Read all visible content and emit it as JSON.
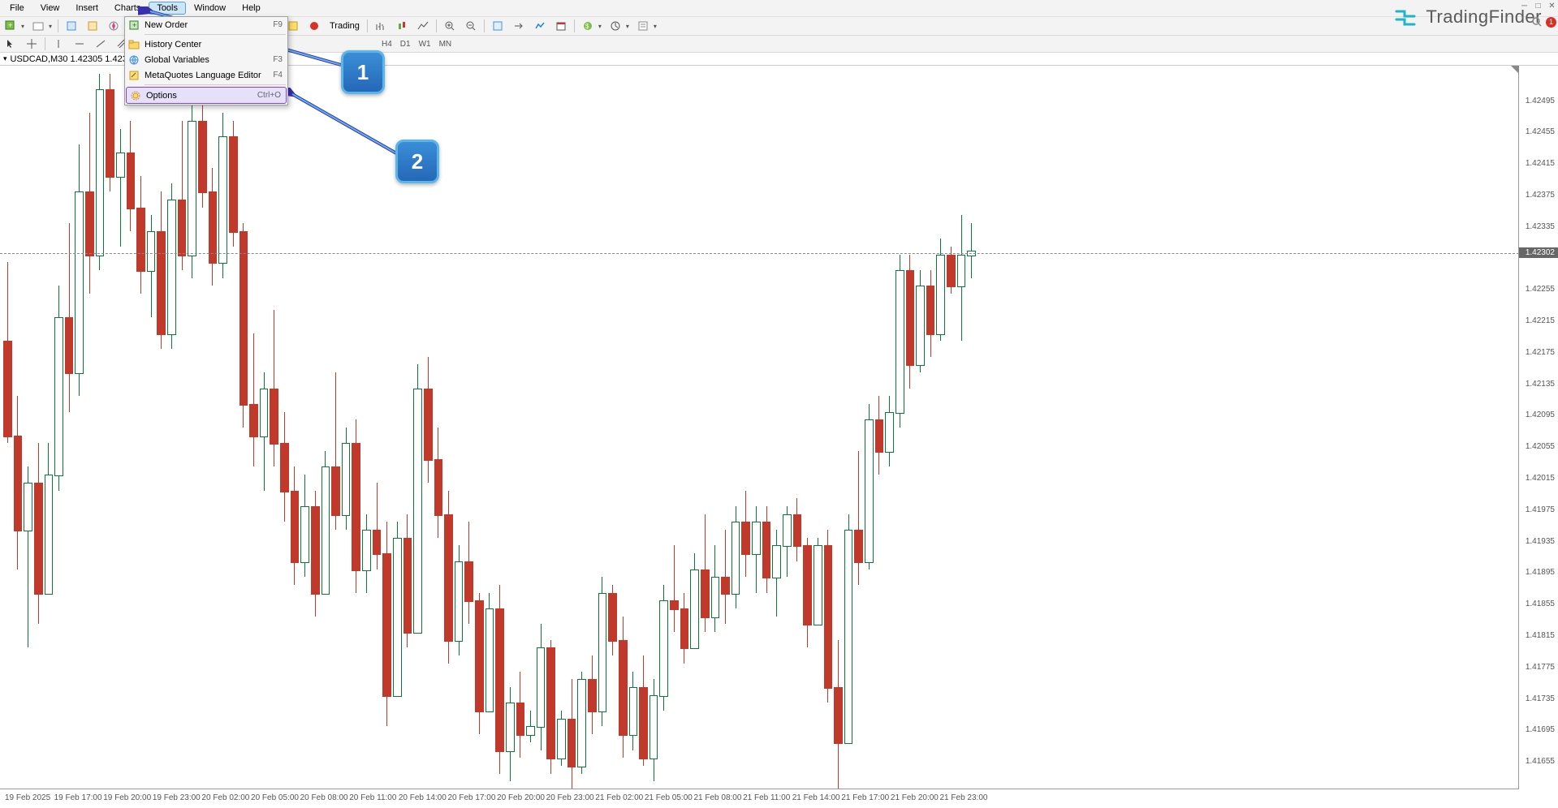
{
  "menu": {
    "items": [
      "File",
      "View",
      "Insert",
      "Charts",
      "Tools",
      "Window",
      "Help"
    ],
    "selected": 4
  },
  "dropdown": {
    "items": [
      {
        "label": "New Order",
        "shortcut": "F9",
        "icon": "plus"
      },
      {
        "sep": true
      },
      {
        "label": "History Center",
        "shortcut": "",
        "icon": "folder"
      },
      {
        "label": "Global Variables",
        "shortcut": "F3",
        "icon": "globe"
      },
      {
        "label": "MetaQuotes Language Editor",
        "shortcut": "F4",
        "icon": "edit"
      },
      {
        "sep": true
      },
      {
        "label": "Options",
        "shortcut": "Ctrl+O",
        "icon": "gear",
        "highlight": true
      }
    ]
  },
  "toolbar2_text": "Trading",
  "timeframes": [
    "H4",
    "D1",
    "W1",
    "MN"
  ],
  "chartTitle": "USDCAD,M30  1.42305 1.42350 1.42305 1.4230",
  "brand": "TradingFinder",
  "calloutNum": {
    "one": "1",
    "two": "2"
  },
  "notifCount": "1",
  "currentPrice": "1.42302",
  "chart_data": {
    "type": "candlestick",
    "symbol": "USDCAD",
    "period": "M30",
    "ylim": [
      1.4162,
      1.4254
    ],
    "yticks": [
      "1.42495",
      "1.42455",
      "1.42415",
      "1.42375",
      "1.42335",
      "1.42255",
      "1.42215",
      "1.42175",
      "1.42135",
      "1.42095",
      "1.42055",
      "1.42015",
      "1.41975",
      "1.41935",
      "1.41895",
      "1.41855",
      "1.41815",
      "1.41775",
      "1.41735",
      "1.41695",
      "1.41655"
    ],
    "xticks": [
      "19 Feb 2025",
      "19 Feb 17:00",
      "19 Feb 20:00",
      "19 Feb 23:00",
      "20 Feb 02:00",
      "20 Feb 05:00",
      "20 Feb 08:00",
      "20 Feb 11:00",
      "20 Feb 14:00",
      "20 Feb 17:00",
      "20 Feb 20:00",
      "20 Feb 23:00",
      "21 Feb 02:00",
      "21 Feb 05:00",
      "21 Feb 08:00",
      "21 Feb 11:00",
      "21 Feb 14:00",
      "21 Feb 17:00",
      "21 Feb 20:00",
      "21 Feb 23:00"
    ],
    "ohlc": [
      [
        1.4219,
        1.4229,
        1.4206,
        1.4207
      ],
      [
        1.4207,
        1.4212,
        1.419,
        1.4195
      ],
      [
        1.4195,
        1.4203,
        1.418,
        1.4201
      ],
      [
        1.4201,
        1.4206,
        1.4183,
        1.4187
      ],
      [
        1.4187,
        1.4206,
        1.4187,
        1.4202
      ],
      [
        1.4202,
        1.4226,
        1.42,
        1.4222
      ],
      [
        1.4222,
        1.4234,
        1.421,
        1.4215
      ],
      [
        1.4215,
        1.4244,
        1.4212,
        1.4238
      ],
      [
        1.4238,
        1.4248,
        1.4225,
        1.423
      ],
      [
        1.423,
        1.4253,
        1.4228,
        1.4251
      ],
      [
        1.4251,
        1.4253,
        1.4238,
        1.424
      ],
      [
        1.424,
        1.4246,
        1.4231,
        1.4243
      ],
      [
        1.4243,
        1.4247,
        1.4233,
        1.4236
      ],
      [
        1.4236,
        1.424,
        1.4225,
        1.4228
      ],
      [
        1.4228,
        1.4235,
        1.4222,
        1.4233
      ],
      [
        1.4233,
        1.4238,
        1.4218,
        1.422
      ],
      [
        1.422,
        1.4239,
        1.4218,
        1.4237
      ],
      [
        1.4237,
        1.4247,
        1.4228,
        1.423
      ],
      [
        1.423,
        1.4251,
        1.4227,
        1.4247
      ],
      [
        1.4247,
        1.425,
        1.4236,
        1.4238
      ],
      [
        1.4238,
        1.4241,
        1.4226,
        1.4229
      ],
      [
        1.4229,
        1.4248,
        1.4227,
        1.4245
      ],
      [
        1.4245,
        1.4247,
        1.4231,
        1.4233
      ],
      [
        1.4233,
        1.4234,
        1.4208,
        1.4211
      ],
      [
        1.4211,
        1.422,
        1.4203,
        1.4207
      ],
      [
        1.4207,
        1.4215,
        1.42,
        1.4213
      ],
      [
        1.4213,
        1.4223,
        1.4203,
        1.4206
      ],
      [
        1.4206,
        1.421,
        1.4196,
        1.42
      ],
      [
        1.42,
        1.4203,
        1.4188,
        1.4191
      ],
      [
        1.4191,
        1.4202,
        1.4189,
        1.4198
      ],
      [
        1.4198,
        1.42,
        1.4184,
        1.4187
      ],
      [
        1.4187,
        1.4205,
        1.4187,
        1.4203
      ],
      [
        1.4203,
        1.4215,
        1.4195,
        1.4197
      ],
      [
        1.4197,
        1.4208,
        1.4195,
        1.4206
      ],
      [
        1.4206,
        1.4209,
        1.4187,
        1.419
      ],
      [
        1.419,
        1.4197,
        1.4187,
        1.4195
      ],
      [
        1.4195,
        1.4201,
        1.419,
        1.4192
      ],
      [
        1.4192,
        1.4196,
        1.417,
        1.4174
      ],
      [
        1.4174,
        1.4196,
        1.4174,
        1.4194
      ],
      [
        1.4194,
        1.4197,
        1.418,
        1.4182
      ],
      [
        1.4182,
        1.4216,
        1.4182,
        1.4213
      ],
      [
        1.4213,
        1.4217,
        1.4201,
        1.4204
      ],
      [
        1.4204,
        1.4208,
        1.4194,
        1.4197
      ],
      [
        1.4197,
        1.42,
        1.4178,
        1.4181
      ],
      [
        1.4181,
        1.4193,
        1.4179,
        1.4191
      ],
      [
        1.4191,
        1.4196,
        1.4183,
        1.4186
      ],
      [
        1.4186,
        1.4187,
        1.4169,
        1.4172
      ],
      [
        1.4172,
        1.4187,
        1.4172,
        1.4185
      ],
      [
        1.4185,
        1.4188,
        1.4164,
        1.4167
      ],
      [
        1.4167,
        1.4175,
        1.4163,
        1.4173
      ],
      [
        1.4173,
        1.4177,
        1.4166,
        1.4169
      ],
      [
        1.4169,
        1.4172,
        1.4168,
        1.417
      ],
      [
        1.417,
        1.4183,
        1.4167,
        1.418
      ],
      [
        1.418,
        1.4181,
        1.4164,
        1.4166
      ],
      [
        1.4166,
        1.4172,
        1.4165,
        1.4171
      ],
      [
        1.4171,
        1.4176,
        1.4162,
        1.4165
      ],
      [
        1.4165,
        1.4177,
        1.4164,
        1.4176
      ],
      [
        1.4176,
        1.4179,
        1.4169,
        1.4172
      ],
      [
        1.4172,
        1.4189,
        1.417,
        1.4187
      ],
      [
        1.4187,
        1.4188,
        1.4179,
        1.4181
      ],
      [
        1.4181,
        1.4184,
        1.4166,
        1.4169
      ],
      [
        1.4169,
        1.4177,
        1.4167,
        1.4175
      ],
      [
        1.4175,
        1.4179,
        1.4165,
        1.4166
      ],
      [
        1.4166,
        1.4176,
        1.4163,
        1.4174
      ],
      [
        1.4174,
        1.4188,
        1.4172,
        1.4186
      ],
      [
        1.4186,
        1.4193,
        1.4182,
        1.4185
      ],
      [
        1.4185,
        1.4187,
        1.4178,
        1.418
      ],
      [
        1.418,
        1.4192,
        1.418,
        1.419
      ],
      [
        1.419,
        1.4197,
        1.4182,
        1.4184
      ],
      [
        1.4184,
        1.4193,
        1.4182,
        1.4189
      ],
      [
        1.4189,
        1.4195,
        1.4183,
        1.4187
      ],
      [
        1.4187,
        1.4198,
        1.4185,
        1.4196
      ],
      [
        1.4196,
        1.42,
        1.4189,
        1.4192
      ],
      [
        1.4192,
        1.4198,
        1.4187,
        1.4196
      ],
      [
        1.4196,
        1.4198,
        1.4187,
        1.4189
      ],
      [
        1.4189,
        1.4195,
        1.4184,
        1.4193
      ],
      [
        1.4193,
        1.4198,
        1.4189,
        1.4197
      ],
      [
        1.4197,
        1.4199,
        1.4191,
        1.4193
      ],
      [
        1.4193,
        1.4194,
        1.418,
        1.4183
      ],
      [
        1.4183,
        1.4194,
        1.4183,
        1.4193
      ],
      [
        1.4193,
        1.4195,
        1.4173,
        1.4175
      ],
      [
        1.4175,
        1.4181,
        1.4162,
        1.4168
      ],
      [
        1.4168,
        1.4197,
        1.4168,
        1.4195
      ],
      [
        1.4195,
        1.4205,
        1.4188,
        1.4191
      ],
      [
        1.4191,
        1.4211,
        1.419,
        1.4209
      ],
      [
        1.4209,
        1.4212,
        1.4202,
        1.4205
      ],
      [
        1.4205,
        1.4212,
        1.4203,
        1.421
      ],
      [
        1.421,
        1.423,
        1.4208,
        1.4228
      ],
      [
        1.4228,
        1.423,
        1.4213,
        1.4216
      ],
      [
        1.4216,
        1.4228,
        1.4215,
        1.4226
      ],
      [
        1.4226,
        1.4228,
        1.4217,
        1.422
      ],
      [
        1.422,
        1.4232,
        1.4219,
        1.423
      ],
      [
        1.423,
        1.4231,
        1.4225,
        1.4226
      ],
      [
        1.4226,
        1.4235,
        1.4219,
        1.423
      ],
      [
        1.423,
        1.4234,
        1.4227,
        1.42305
      ]
    ]
  }
}
